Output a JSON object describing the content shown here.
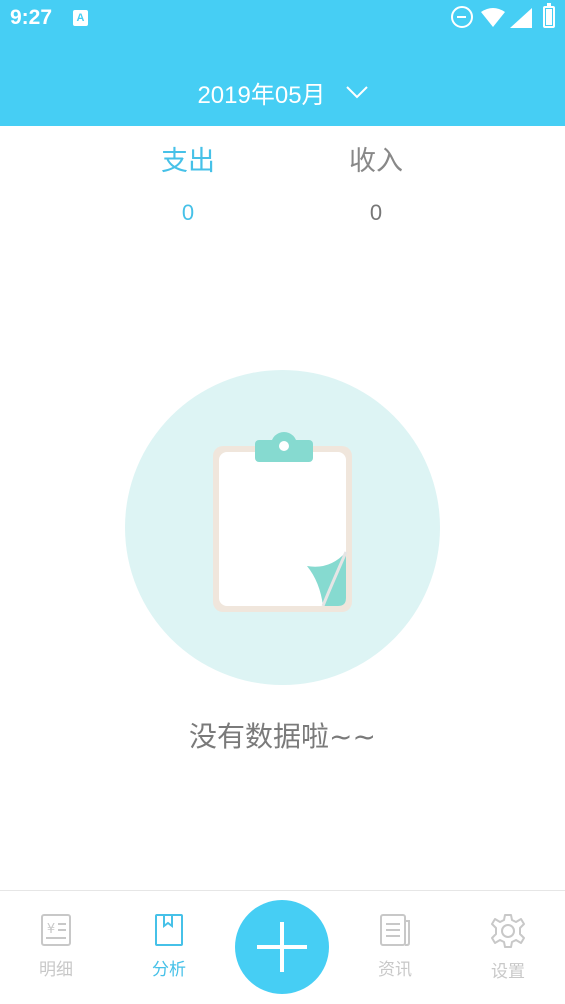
{
  "status_bar": {
    "time": "9:27",
    "app_icon_glyph": "A",
    "icons": [
      "dnd-icon",
      "wifi-icon",
      "signal-icon",
      "battery-icon"
    ]
  },
  "header": {
    "month": "2019年05月",
    "dropdown_icon": "chevron-down-icon",
    "background_color": "#46cef4"
  },
  "summary": {
    "expense": {
      "label": "支出",
      "value": "0",
      "active": true
    },
    "income": {
      "label": "收入",
      "value": "0",
      "active": false
    }
  },
  "empty_state": {
    "icon": "clipboard-icon",
    "message": "没有数据啦~~"
  },
  "tabbar": {
    "tabs": [
      {
        "label": "明细",
        "icon": "ledger-icon",
        "active": false
      },
      {
        "label": "分析",
        "icon": "book-icon",
        "active": true
      },
      {
        "label": "资讯",
        "icon": "news-icon",
        "active": false
      },
      {
        "label": "设置",
        "icon": "gear-icon",
        "active": false
      }
    ],
    "add_icon": "plus-icon",
    "accent_color": "#46c1e8",
    "inactive_color": "#c8c8c8"
  }
}
